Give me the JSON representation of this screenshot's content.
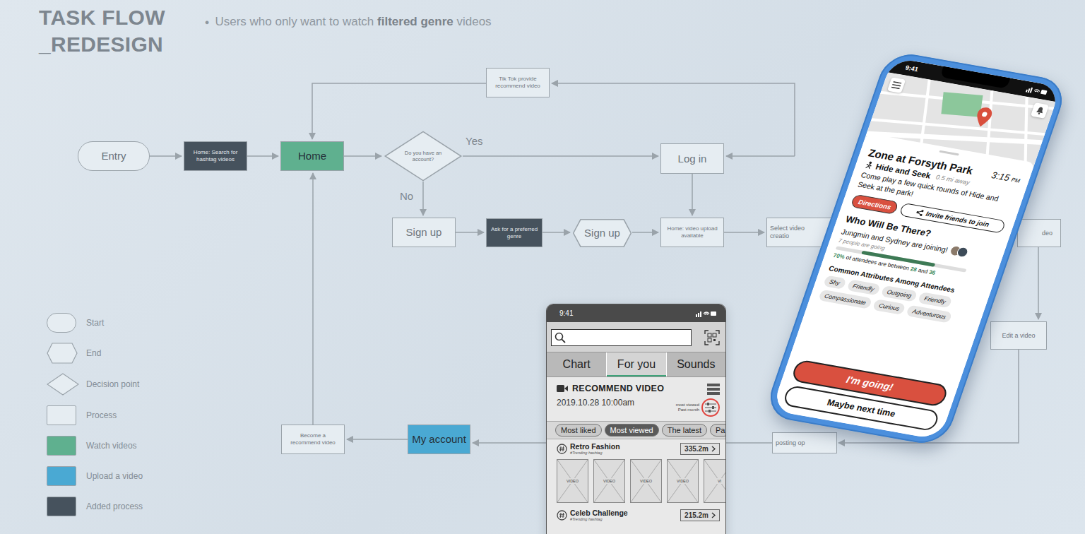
{
  "slide": {
    "title": [
      "TASK FLOW",
      "_REDESIGN"
    ],
    "bullet": "●",
    "subtitle_before": "Users who only want to watch ",
    "subtitle_bold": "filtered genre",
    "subtitle_after": " videos"
  },
  "flow": {
    "nodes": [
      {
        "label": "Entry",
        "kind": "start",
        "color": "#e6edf2"
      },
      {
        "label": "Home: Search for hashtag videos",
        "kind": "process",
        "color": "#46525d"
      },
      {
        "label": "Home",
        "kind": "process",
        "color": "#5fb08f"
      },
      {
        "label": "Do you have an account?",
        "kind": "decision",
        "color": "#e6edf2"
      },
      {
        "label": "Log in",
        "kind": "process",
        "color": "#e6edf2"
      },
      {
        "label": "Tik Tok provide recommend video",
        "kind": "process",
        "color": "#e6edf2"
      },
      {
        "label": "Sign up",
        "kind": "process",
        "color": "#e6edf2"
      },
      {
        "label": "Ask for a preferred genre",
        "kind": "process",
        "color": "#46525d"
      },
      {
        "label": "Sign up",
        "kind": "end",
        "color": "#e6edf2"
      },
      {
        "label": "Home: video upload available",
        "kind": "process",
        "color": "#e6edf2"
      },
      {
        "label": "Select video creatio",
        "kind": "process",
        "color": "#e6edf2"
      },
      {
        "label": "deo",
        "kind": "process",
        "color": "#e6edf2"
      },
      {
        "label": "Edit a video",
        "kind": "process",
        "color": "#e6edf2"
      },
      {
        "label": "posting op",
        "kind": "process",
        "color": "#e6edf2"
      },
      {
        "label": "My account",
        "kind": "process",
        "color": "#4aa9d3"
      },
      {
        "label": "Become a recommend video",
        "kind": "process",
        "color": "#e6edf2"
      }
    ],
    "edge_labels": [
      "Yes",
      "No"
    ]
  },
  "legend": [
    {
      "label": "Start",
      "kind": "start",
      "color": "#e6edf2"
    },
    {
      "label": "End",
      "kind": "end",
      "color": "#e6edf2"
    },
    {
      "label": "Decision point",
      "kind": "decision",
      "color": "#e6edf2"
    },
    {
      "label": "Process",
      "kind": "process",
      "color": "#e6edf2"
    },
    {
      "label": "Watch videos",
      "kind": "process",
      "color": "#5fb08f"
    },
    {
      "label": "Upload a video",
      "kind": "process",
      "color": "#4aa9d3"
    },
    {
      "label": "Added process",
      "kind": "process",
      "color": "#46525d"
    }
  ],
  "wireframe": {
    "status_time": "9:41",
    "tabs": [
      {
        "label": "Chart",
        "selected": false
      },
      {
        "label": "For you",
        "selected": true
      },
      {
        "label": "Sounds",
        "selected": false
      }
    ],
    "section": {
      "title": "RECOMMEND VIDEO",
      "date": "2019.10.28 10:00am",
      "sort_label": "most viewed",
      "period_label": "Past month",
      "filter_highlighted": true
    },
    "chips": [
      {
        "label": "Most liked",
        "selected": false
      },
      {
        "label": "Most viewed",
        "selected": true
      },
      {
        "label": "The latest",
        "selected": false
      },
      {
        "label": "Pa",
        "selected": false
      }
    ],
    "hashtags": [
      {
        "name": "Retro Fashion",
        "sub": "#Trending hashtag",
        "count": "335.2m",
        "thumbs": [
          "VIDEO",
          "VIDEO",
          "VIDEO",
          "VIDEO",
          "VI"
        ]
      },
      {
        "name": "Celeb Challenge",
        "sub": "#Trending hashtag",
        "count": "215.2m",
        "thumbs": []
      }
    ]
  },
  "event_app": {
    "status_time": "9:41",
    "title": "Zone at Forsyth Park",
    "time": "3:15",
    "time_suffix": "PM",
    "activity": "Hide and Seek",
    "distance": "0.5 mi away",
    "description": "Come play a few quick rounds of Hide and Seek at the park!",
    "actions": [
      {
        "label": "Directions",
        "kind": "primary"
      },
      {
        "label": "Invite friends to join",
        "kind": "share"
      }
    ],
    "attendance": {
      "heading": "Who Will Be There?",
      "joining": "Jungmin and Sydney are joining!",
      "going": "7 people are going",
      "level": 0.7,
      "percent": "70%",
      "between": "of attendees are between",
      "low": "28",
      "and": "and",
      "high": "36"
    },
    "attributes": {
      "heading": "Common Attributes Among Attendees",
      "tags": [
        "Shy",
        "Friendly",
        "Outgoing",
        "Friendly",
        "Compassionate",
        "Curious",
        "Adventurous"
      ]
    },
    "buttons": [
      {
        "label": "I'm going!",
        "kind": "primary"
      },
      {
        "label": "Maybe next time",
        "kind": "secondary"
      }
    ]
  }
}
